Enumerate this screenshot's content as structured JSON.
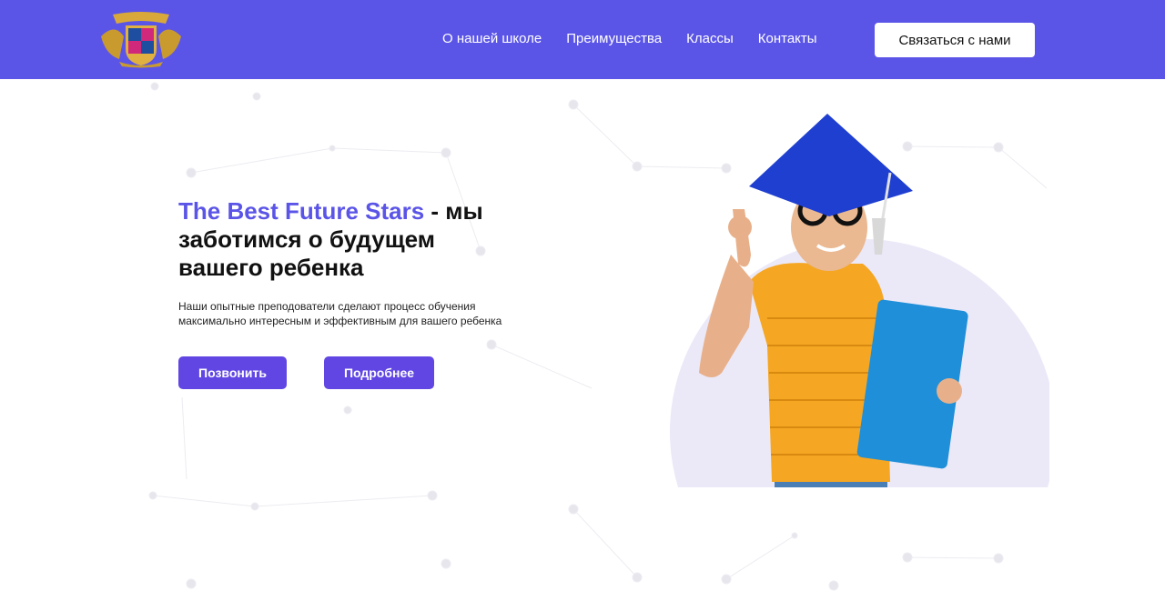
{
  "header": {
    "logo_alt": "The Best Future Stars",
    "nav": [
      {
        "label": "О нашей школе"
      },
      {
        "label": "Преимущества"
      },
      {
        "label": "Классы"
      },
      {
        "label": "Контакты"
      }
    ],
    "cta_label": "Связаться с нами"
  },
  "hero": {
    "title_accent": "The Best Future Stars",
    "title_rest": " - мы заботимся о будущем вашего ребенка",
    "description": "Наши опытные преподователи сделают процесс обучения максимально интересным и эффективным для вашего ребенка",
    "call_button": "Позвонить",
    "more_button": "Подробнее"
  },
  "colors": {
    "brand": "#5b55e7",
    "button": "#6146e3"
  }
}
